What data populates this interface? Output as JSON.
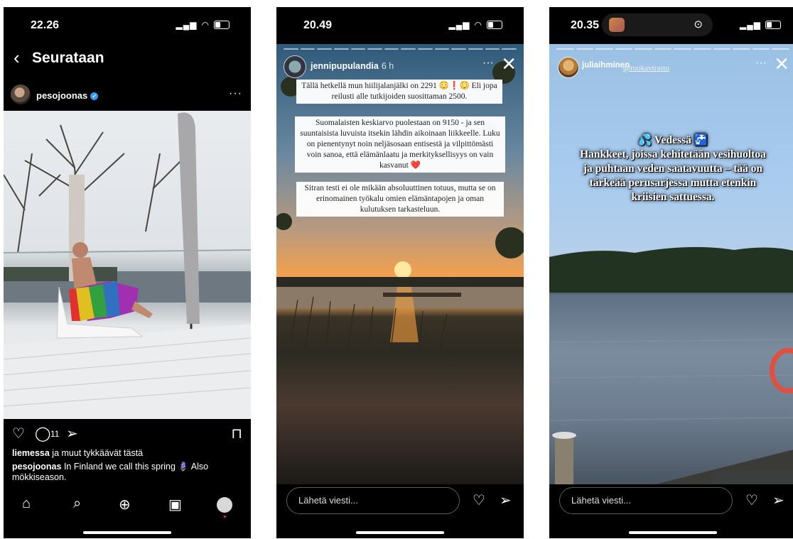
{
  "phone1": {
    "status_time": "22.26",
    "nav_title": "Seurataan",
    "username": "pesojoonas",
    "comment_count": "11",
    "likes_user": "liemessa",
    "likes_text": " ja muut tykkäävät tästä",
    "caption_user": "pesojoonas",
    "caption_text": " In Finland we call this spring 🪻 Also mökkiseason."
  },
  "phone2": {
    "status_time": "20.49",
    "username": "jennipupulandia",
    "post_age": "6 h",
    "text_block_1": "Tällä hetkellä mun hiilijalanjälki on 2291 😳❗😳 Eli jopa reilusti alle tutkijoiden suosittaman 2500.",
    "text_block_2": "Suomalaisten keskiarvo puolestaan on 9150 - ja sen suuntaisista luvuista itsekin lähdin aikoinaan liikkeelle. Luku on pienentynyt noin neljäsosaan entisestä ja vilpittömästi voin sanoa, että elämänlaatu ja merkityksellisyys on vain kasvanut ❤️",
    "text_block_3": "Sitran testi ei ole mikään absoluuttinen totuus, mutta se on erinomainen työkalu omien elämäntapojen ja oman kulutuksen tarkasteluun.",
    "reply_placeholder": "Lähetä viesti..."
  },
  "phone3": {
    "status_time": "20.35",
    "username": "juliaihminen",
    "mention": "@ruokavirasto",
    "story_heading": "💦 Vedessä 🚰",
    "story_text": "Hankkeet, joissa kehitetään vesihuoltoa ja puhtaan veden saatavuutta – tää on tärkeää perusarjessa mutta etenkin kriisien sattuessa.",
    "reply_placeholder": "Lähetä viesti..."
  },
  "colors": {
    "background": "#000000",
    "verified_badge": "#3897f0",
    "notification_dot": "#ff3040"
  }
}
